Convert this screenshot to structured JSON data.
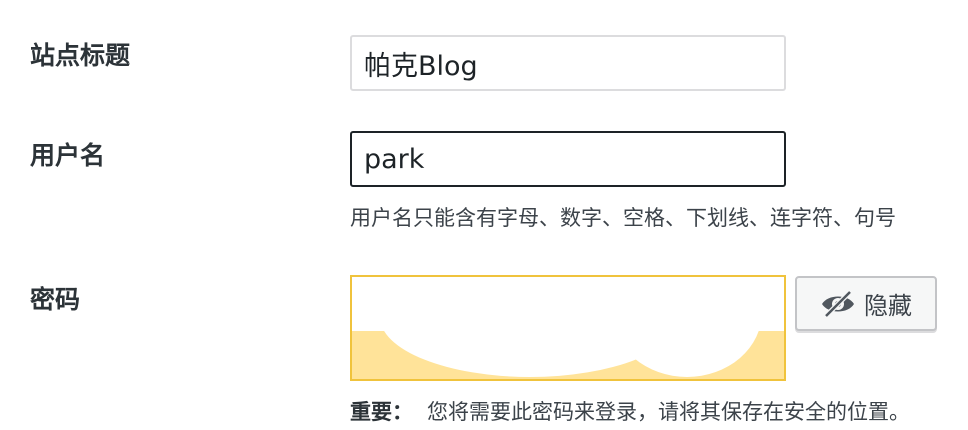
{
  "site_title": {
    "label": "站点标题",
    "value": "帕克Blog"
  },
  "username": {
    "label": "用户名",
    "value": "park",
    "hint": "用户名只能含有字母、数字、空格、下划线、连字符、句号"
  },
  "password": {
    "label": "密码",
    "strength_color": "#ffe399",
    "toggle_icon": "eye-slash-icon",
    "toggle_label": "隐藏",
    "important_label": "重要：",
    "important_text": "您将需要此密码来登录，请将其保存在安全的位置。"
  }
}
